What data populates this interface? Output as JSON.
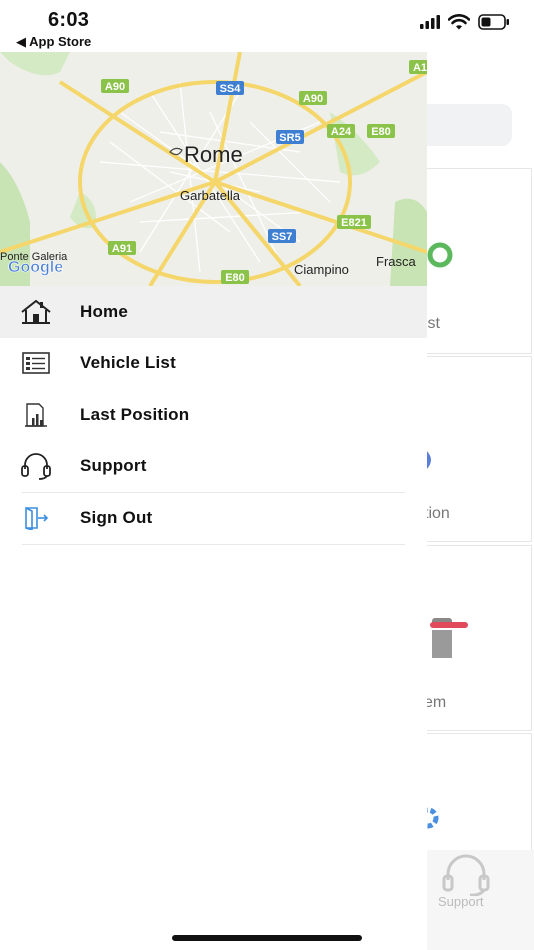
{
  "status_bar": {
    "time": "6:03",
    "back_app": "◀ App Store",
    "icons": [
      "signal-icon",
      "wifi-icon",
      "battery-icon"
    ]
  },
  "map": {
    "labels": {
      "city": "Rome",
      "garbatella": "Garbatella",
      "ciampino": "Ciampino",
      "frasca": "Frasca",
      "ponte_galeria": "Ponte Galeria",
      "google": "Google"
    },
    "road_badges": {
      "a90_left": "A90",
      "a90_top": "A90",
      "ss4": "SS4",
      "a1": "A1",
      "sr5": "SR5",
      "a24": "A24",
      "e80_top": "E80",
      "e821": "E821",
      "ss7": "SS7",
      "a91": "A91",
      "e80_bottom": "E80"
    }
  },
  "menu": {
    "items": [
      {
        "label": "Home",
        "icon": "home-icon",
        "active": true
      },
      {
        "label": "Vehicle List",
        "icon": "vehicle-list-icon",
        "active": false
      },
      {
        "label": "Last Position",
        "icon": "last-position-icon",
        "active": false
      },
      {
        "label": "Support",
        "icon": "headset-icon",
        "active": false
      },
      {
        "label": "Sign Out",
        "icon": "sign-out-icon",
        "active": false
      }
    ]
  },
  "background_app": {
    "card_labels": [
      "ist",
      "tion",
      "em"
    ],
    "bottom_nav_label": "Support"
  },
  "colors": {
    "active_row": "#f0f0f0",
    "motorway_badge": "#8bc34a",
    "state_road_badge": "#3f7fd1",
    "road_yellow": "#f5d66a",
    "park_green": "#c9e4b4"
  }
}
